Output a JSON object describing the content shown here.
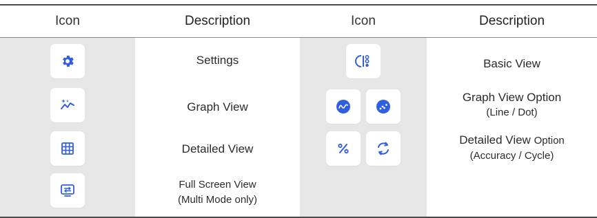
{
  "headers": {
    "icon_1": "Icon",
    "description_1": "Description",
    "icon_2": "Icon",
    "description_2": "Description"
  },
  "left_rows": [
    {
      "icon": "gear-icon",
      "label": "Settings"
    },
    {
      "icon": "sparkle-graph-icon",
      "label": "Graph View"
    },
    {
      "icon": "grid-table-icon",
      "label": "Detailed View"
    },
    {
      "icon": "monitor-swap-icon",
      "label": "Full Screen View",
      "sublabel": "(Multi Mode only)"
    }
  ],
  "right_rows": [
    {
      "icons": [
        "basic-view-icon"
      ],
      "label": "Basic View"
    },
    {
      "icons": [
        "line-graph-icon",
        "dot-graph-icon"
      ],
      "label": "Graph View Option",
      "sublabel": "(Line / Dot)"
    },
    {
      "icons": [
        "percent-icon",
        "cycle-icon"
      ],
      "label": "Detailed View",
      "label_suffix": "Option",
      "sublabel": "(Accuracy / Cycle)"
    }
  ],
  "colors": {
    "icon_blue": "#2f5fe0",
    "column_gray": "#e6e6e6",
    "rule": "#4a4a4a"
  }
}
